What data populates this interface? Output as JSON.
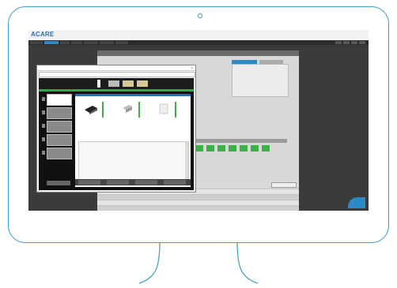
{
  "app": {
    "logo": "ACARE",
    "user": "",
    "nav_tabs": [
      "",
      "",
      "",
      "",
      "",
      "",
      ""
    ],
    "active_tab_index": 1
  },
  "main_window": {
    "title": "",
    "side_button": ""
  },
  "dialog": {
    "title": "",
    "close_glyph": "x",
    "panel_title": "",
    "trays": [
      {
        "label": "",
        "icon": "printer-tray-icon"
      },
      {
        "label": "",
        "icon": "paper-tray-icon"
      },
      {
        "label": "",
        "icon": "document-icon"
      }
    ]
  },
  "colors": {
    "frame": "#3a9bc9",
    "accent": "#2a8ac8",
    "green": "#3fae49"
  }
}
